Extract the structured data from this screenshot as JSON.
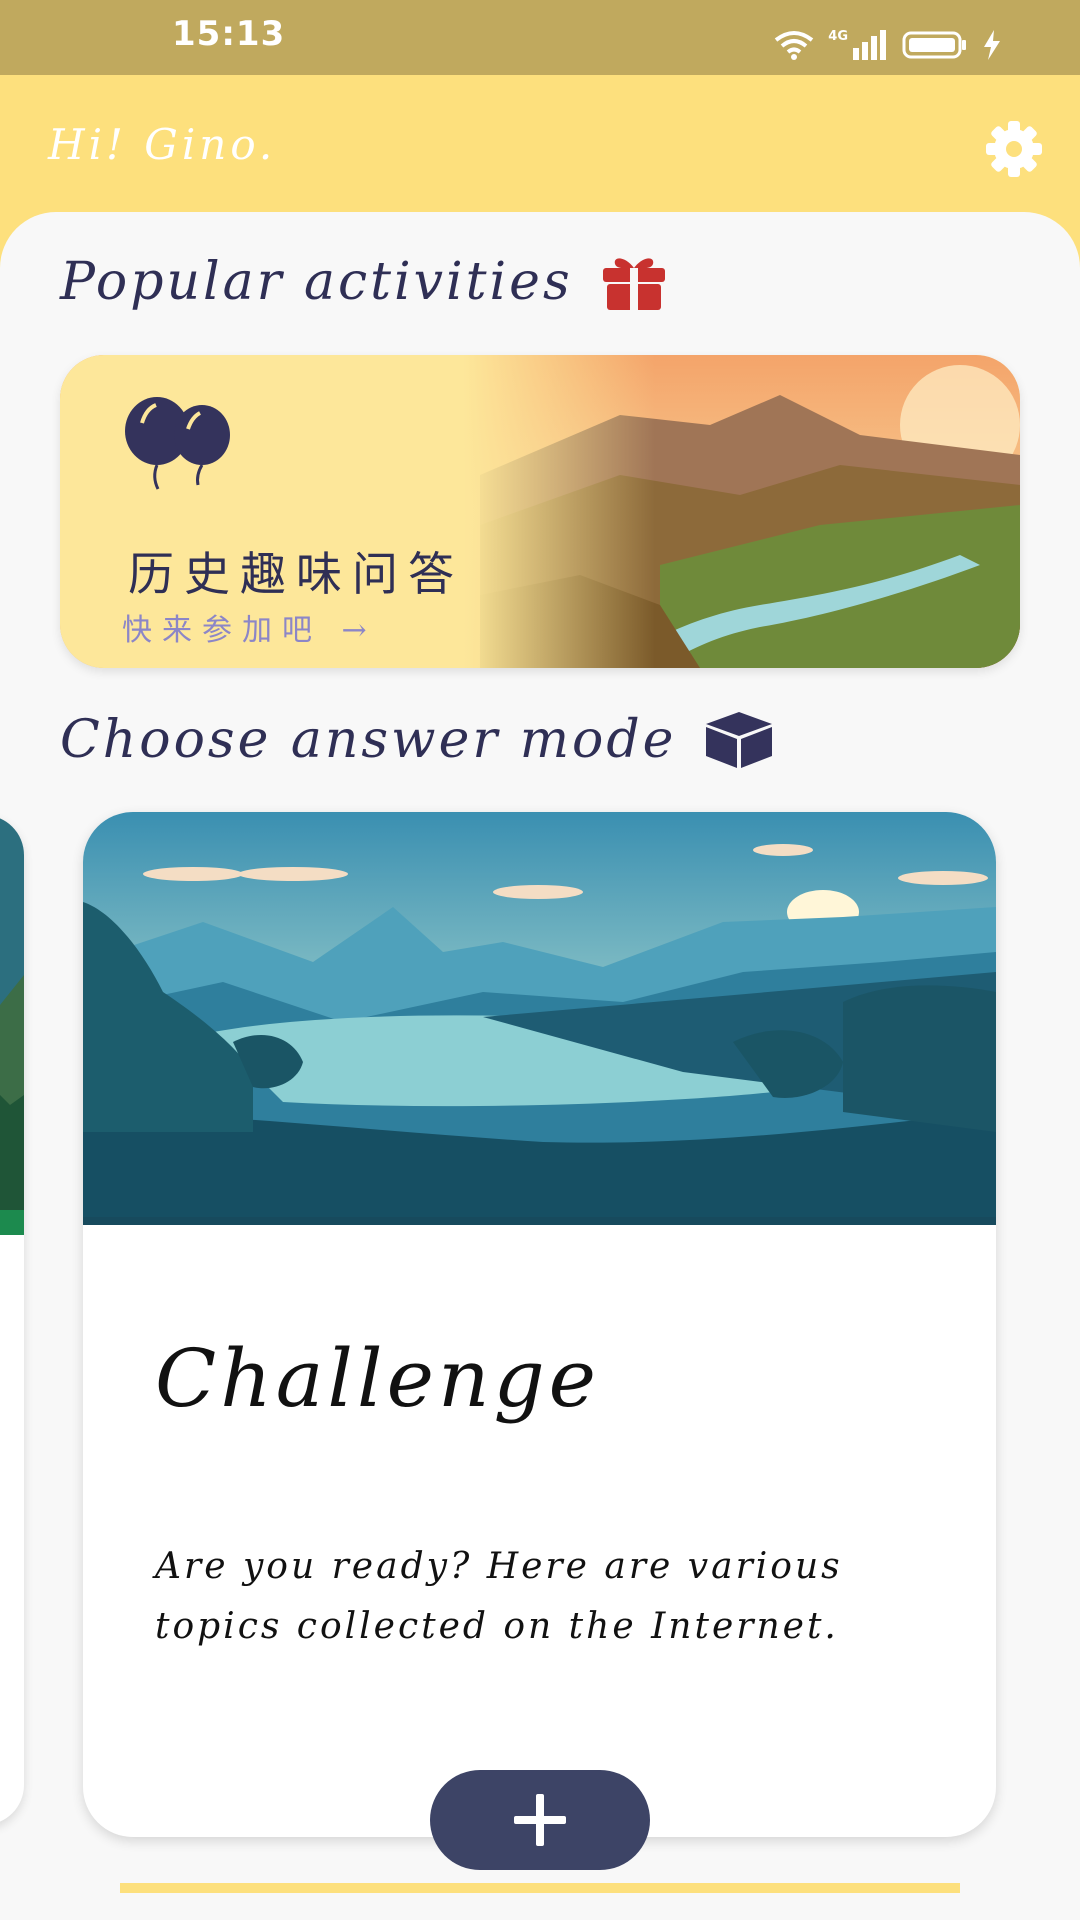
{
  "status_bar": {
    "time": "15:13",
    "network": "4G",
    "icons": [
      "wifi-icon",
      "signal-icon",
      "battery-icon",
      "charging-icon"
    ]
  },
  "header": {
    "greeting": "Hi!  Gino.",
    "settings_icon": "gear-icon"
  },
  "popular": {
    "title": "Popular activities",
    "icon": "gift-icon",
    "card": {
      "title": "历史趣味问答",
      "subtitle": "快来参加吧 →",
      "icon": "balloons-icon"
    }
  },
  "modes": {
    "title": "Choose answer mode",
    "icon": "cube-icon",
    "current": {
      "title": "Challenge",
      "description": "Are you ready? Here are various topics collected on the Internet."
    }
  },
  "fab": {
    "icon": "plus-icon"
  },
  "colors": {
    "status_bar": "#c0a95e",
    "header": "#fde07d",
    "background": "#f8f8f8",
    "title_text": "#2f2f55",
    "accent": "#3d4466",
    "gift": "#c8322f",
    "subtitle": "#8c86c7"
  }
}
